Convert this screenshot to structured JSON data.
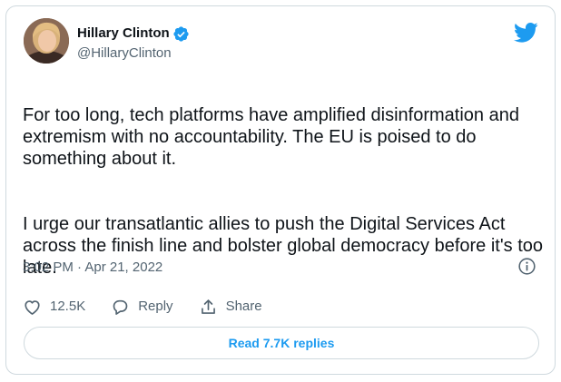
{
  "author": {
    "display_name": "Hillary Clinton",
    "handle": "@HillaryClinton",
    "verified": true
  },
  "tweet": {
    "paragraphs": [
      "For too long, tech platforms have amplified disinformation and extremism with no accountability. The EU is poised to do something about it.",
      "I urge our transatlantic allies to push the Digital Services Act across the finish line and bolster global democracy before it's too late."
    ],
    "timestamp": "3:02 PM · Apr 21, 2022"
  },
  "actions": {
    "like_count": "12.5K",
    "reply_label": "Reply",
    "share_label": "Share"
  },
  "read_replies_label": "Read 7.7K replies",
  "icons": {
    "verified": "verified-badge-icon",
    "logo": "twitter-bird-icon",
    "info": "info-icon",
    "like": "heart-icon",
    "reply": "speech-bubble-icon",
    "share": "share-upload-icon"
  },
  "colors": {
    "accent": "#1d9bf0",
    "text_primary": "#0f1419",
    "text_secondary": "#536471",
    "border": "#cfd9de"
  }
}
